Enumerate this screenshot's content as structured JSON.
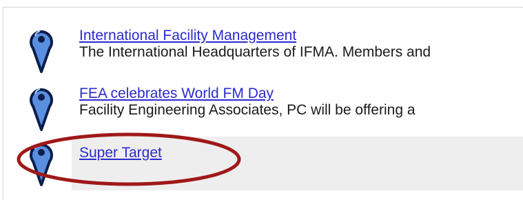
{
  "results": [
    {
      "title": "International Facility Management",
      "snippet": "The International Headquarters of IFMA. Members and",
      "pin_icon": "map-pin-icon"
    },
    {
      "title": "FEA celebrates World FM Day",
      "snippet": "Facility Engineering Associates, PC will be offering a",
      "pin_icon": "map-pin-icon"
    },
    {
      "title": "Super Target",
      "snippet": "",
      "pin_icon": "map-pin-icon"
    }
  ],
  "colors": {
    "link": "#2a2ad0",
    "pin_fill": "#5a8fe0",
    "pin_outline": "#0b1e4a",
    "highlight_row": "#eeeeee",
    "annotation_oval": "#a01818"
  }
}
